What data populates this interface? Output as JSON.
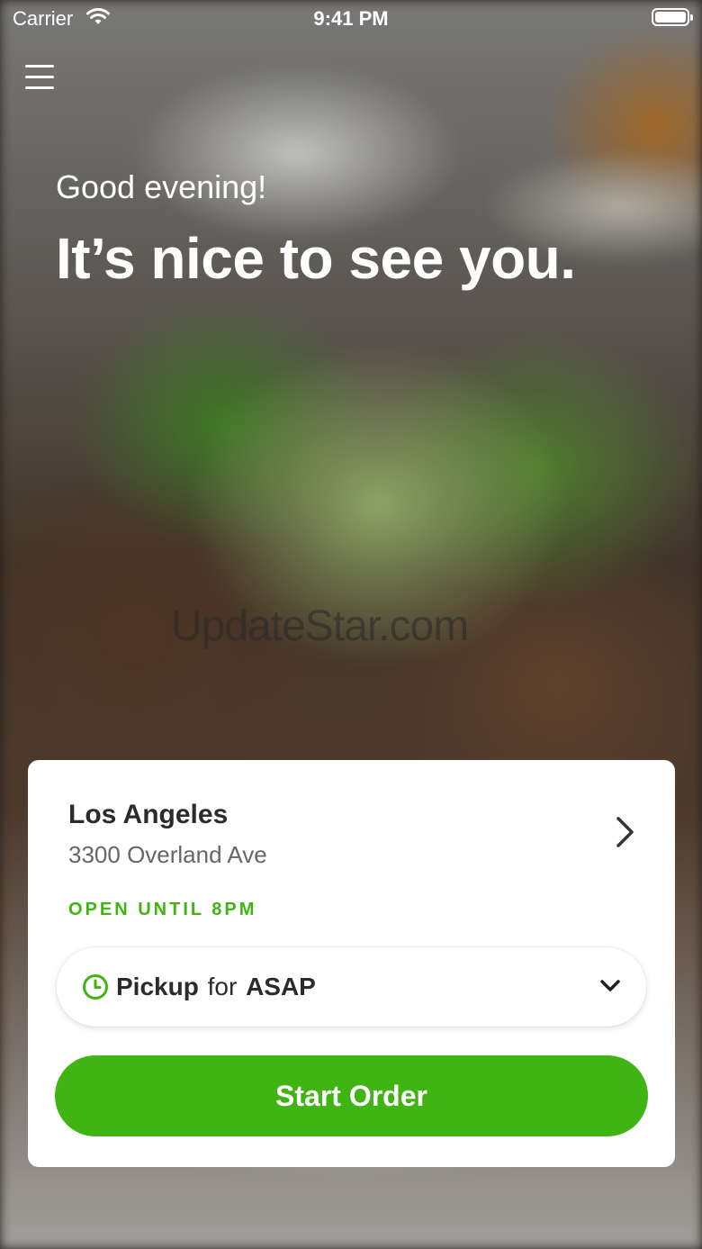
{
  "status_bar": {
    "carrier": "Carrier",
    "time": "9:41 PM"
  },
  "header": {
    "menu_icon": "hamburger-menu-icon"
  },
  "hero": {
    "greeting": "Good evening!",
    "headline": "It’s nice to see you."
  },
  "watermark": "UpdateStar.com",
  "location_card": {
    "name": "Los Angeles",
    "address": "3300 Overland Ave",
    "status": "OPEN UNTIL 8PM",
    "status_color": "#3fb412",
    "order_type": {
      "mode": "Pickup",
      "connector": "for",
      "time": "ASAP"
    },
    "start_button": "Start Order",
    "accent_color": "#3fb412"
  }
}
